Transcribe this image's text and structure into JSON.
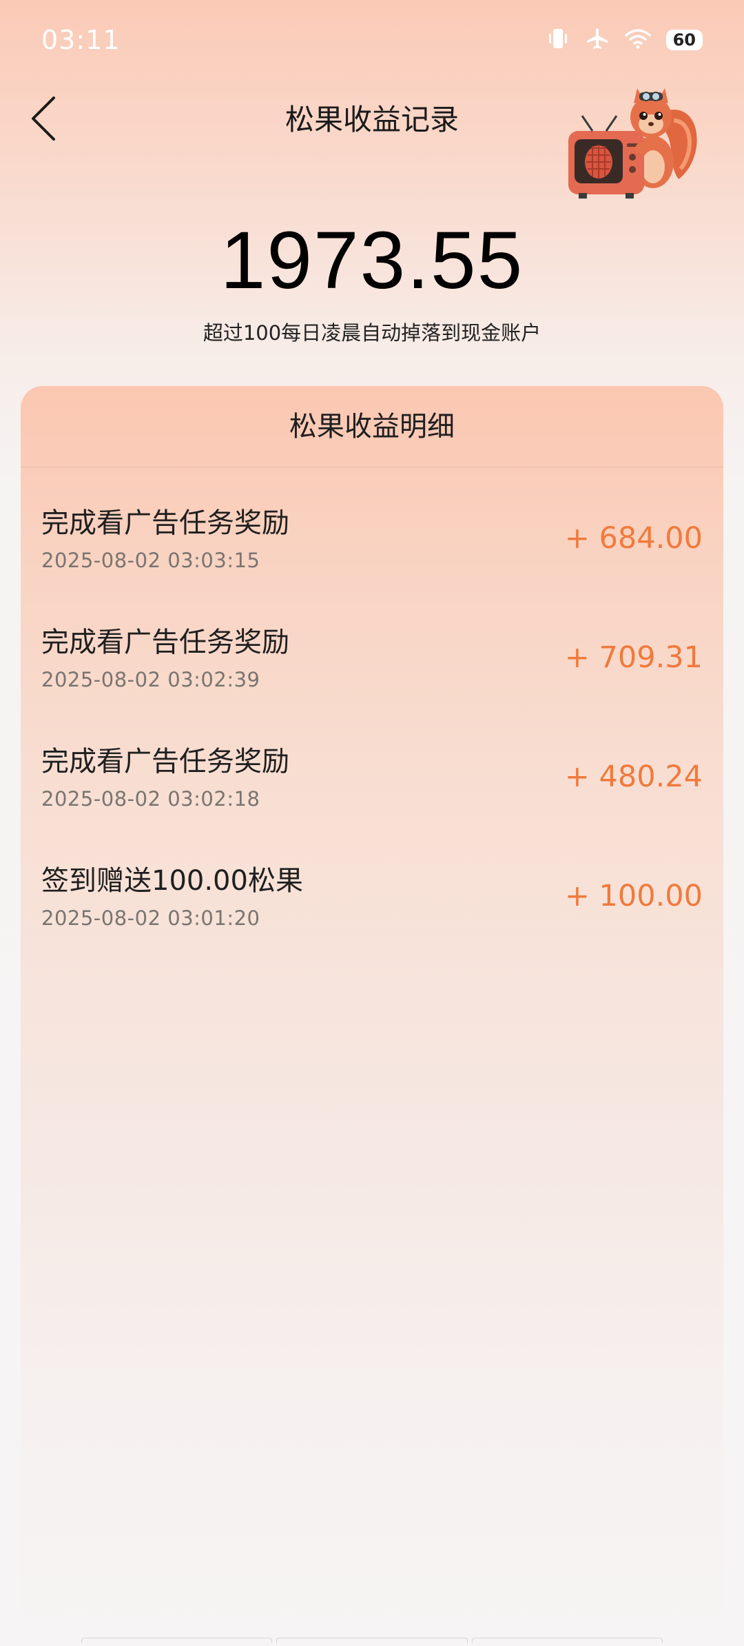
{
  "status_bar": {
    "time": "03:11",
    "battery": "60",
    "icons": [
      "vibrate-icon",
      "airplane-icon",
      "wifi-icon",
      "battery-icon"
    ]
  },
  "header": {
    "title": "松果收益记录",
    "back_icon": "chevron-left-icon",
    "mascot": "squirrel-tv-mascot"
  },
  "summary": {
    "balance": "1973.55",
    "note": "超过100每日凌晨自动掉落到现金账户"
  },
  "detail": {
    "title": "松果收益明细",
    "records": [
      {
        "title": "完成看广告任务奖励",
        "time": "2025-08-02 03:03:15",
        "amount": "+ 684.00"
      },
      {
        "title": "完成看广告任务奖励",
        "time": "2025-08-02 03:02:39",
        "amount": "+ 709.31"
      },
      {
        "title": "完成看广告任务奖励",
        "time": "2025-08-02 03:02:18",
        "amount": "+ 480.24"
      },
      {
        "title": "签到赠送100.00松果",
        "time": "2025-08-02 03:01:20",
        "amount": "+ 100.00"
      }
    ]
  },
  "colors": {
    "amount": "#f07a3c",
    "header_top": "#fbcab6",
    "background": "#f6f4f4"
  }
}
